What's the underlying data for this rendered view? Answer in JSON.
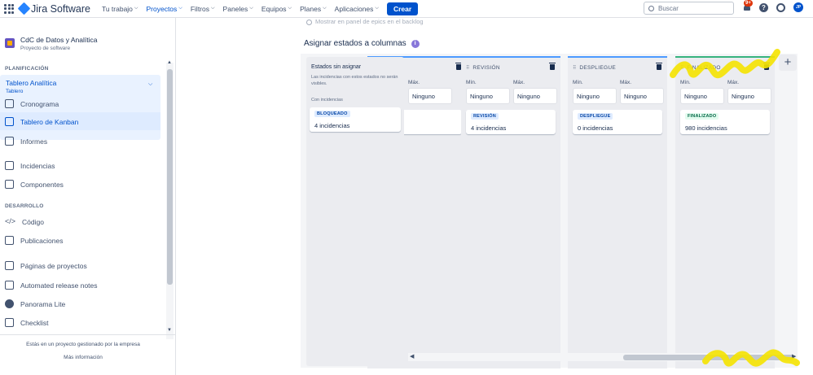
{
  "topnav": {
    "app_name": "Jira Software",
    "items": [
      {
        "label": "Tu trabajo",
        "active": false
      },
      {
        "label": "Proyectos",
        "active": true
      },
      {
        "label": "Filtros",
        "active": false
      },
      {
        "label": "Paneles",
        "active": false
      },
      {
        "label": "Equipos",
        "active": false
      },
      {
        "label": "Planes",
        "active": false
      },
      {
        "label": "Aplicaciones",
        "active": false
      }
    ],
    "create_label": "Crear",
    "search_placeholder": "Buscar",
    "notifications_badge": "9+",
    "help_glyph": "?",
    "avatar_initials": "JP",
    "icons": [
      "app-switcher-icon",
      "jira-logo-icon",
      "search-icon",
      "bell-icon",
      "help-icon",
      "gear-icon"
    ]
  },
  "sidebar": {
    "project_name": "CdC de Datos y Analítica",
    "project_type": "Proyecto de software",
    "planning_header": "PLANIFICACIÓN",
    "board_title": "Tablero Analítica",
    "board_subtitle": "Tablero",
    "planning_items": [
      {
        "label": "Cronograma",
        "icon": "timeline-icon"
      },
      {
        "label": "Tablero de Kanban",
        "icon": "kanban-board-icon",
        "active": true
      },
      {
        "label": "Informes",
        "icon": "reports-icon"
      }
    ],
    "other_items": [
      {
        "label": "Incidencias",
        "icon": "issues-icon"
      },
      {
        "label": "Componentes",
        "icon": "components-icon"
      }
    ],
    "dev_header": "DESARROLLO",
    "dev_items": [
      {
        "label": "Código",
        "icon": "code-icon"
      },
      {
        "label": "Publicaciones",
        "icon": "releases-icon"
      }
    ],
    "extra_items": [
      {
        "label": "Páginas de proyectos",
        "icon": "pages-icon"
      },
      {
        "label": "Automated release notes",
        "icon": "release-notes-icon"
      },
      {
        "label": "Panorama Lite",
        "icon": "panorama-icon"
      },
      {
        "label": "Checklist",
        "icon": "checklist-icon"
      }
    ],
    "footer_text": "Estás en un proyecto gestionado por la empresa",
    "footer_link": "Más información"
  },
  "main": {
    "backlog_hint": "Mostrar en panel de epics en el backlog",
    "assign_title": "Asignar estados a columnas",
    "info_glyph": "i",
    "unassigned": {
      "title": "Estados sin asignar",
      "description": "Las incidencias con estos estados no serán visibles.",
      "subtitle": "Con incidencias",
      "card": {
        "status": "BLOQUEADO",
        "count": "4 incidencias"
      }
    },
    "min_label": "Mín.",
    "max_label": "Máx.",
    "min_value": "Ninguno",
    "max_value": "Ninguno",
    "drag_glyph": "⠿",
    "add_glyph": "+",
    "columns": [
      {
        "name": "",
        "status": "",
        "count": "",
        "color": "#4c9aff"
      },
      {
        "name": "REVISIÓN",
        "status": "REVISIÓN",
        "count": "4 incidencias",
        "color": "#4c9aff"
      },
      {
        "name": "DESPLIEGUE",
        "status": "DESPLIEGUE",
        "count": "0 incidencias",
        "color": "#4c9aff"
      },
      {
        "name": "FINALIZADO",
        "status": "FINALIZADO",
        "count": "980 incidencias",
        "color": "#36b37e"
      }
    ],
    "scroll_left": "◀",
    "scroll_right": "▶"
  }
}
